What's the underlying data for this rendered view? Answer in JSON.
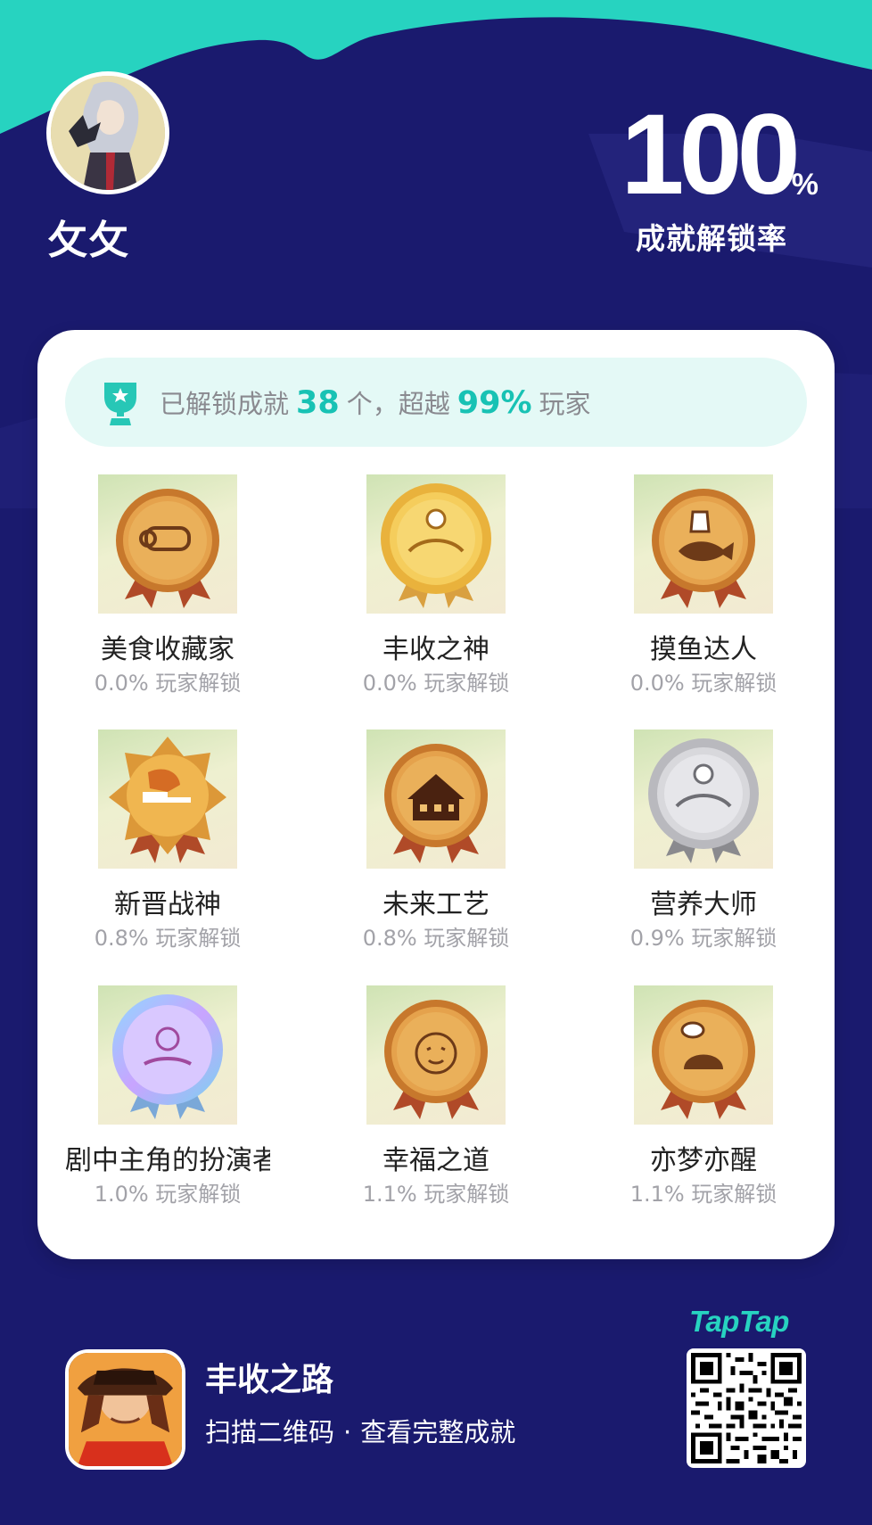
{
  "profile": {
    "user_name": "攵攵",
    "avatar_icon": "user-avatar"
  },
  "completion": {
    "rate_value": "100",
    "rate_unit": "%",
    "label": "成就解锁率"
  },
  "summary": {
    "prefix": "已解锁成就",
    "unlocked_count": "38",
    "middle": "个，超越",
    "beat_percent": "99%",
    "suffix": "玩家",
    "icon": "trophy-icon"
  },
  "achievements": [
    {
      "name": "美食收藏家",
      "rate": "0.0% 玩家解锁",
      "icon": "scroll-medal-icon",
      "tier": "bronze"
    },
    {
      "name": "丰收之神",
      "rate": "0.0% 玩家解锁",
      "icon": "harvest-god-medal-icon",
      "tier": "gold"
    },
    {
      "name": "摸鱼达人",
      "rate": "0.0% 玩家解锁",
      "icon": "fish-medal-icon",
      "tier": "bronze"
    },
    {
      "name": "新晋战神",
      "rate": "0.8% 玩家解锁",
      "icon": "muscle-medal-icon",
      "tier": "gold-star"
    },
    {
      "name": "未来工艺",
      "rate": "0.8% 玩家解锁",
      "icon": "house-medal-icon",
      "tier": "bronze"
    },
    {
      "name": "营养大师",
      "rate": "0.9% 玩家解锁",
      "icon": "nutrition-medal-icon",
      "tier": "silver"
    },
    {
      "name": "剧中主角的扮演者",
      "rate": "1.0% 玩家解锁",
      "icon": "actor-medal-icon",
      "tier": "holographic"
    },
    {
      "name": "幸福之道",
      "rate": "1.1% 玩家解锁",
      "icon": "happy-face-medal-icon",
      "tier": "bronze"
    },
    {
      "name": "亦梦亦醒",
      "rate": "1.1% 玩家解锁",
      "icon": "sleepy-face-medal-icon",
      "tier": "bronze"
    }
  ],
  "footer": {
    "game_name": "丰收之路",
    "scan_text": "扫描二维码",
    "separator": "·",
    "view_text": "查看完整成就",
    "brand": "TapTap",
    "qr_icon": "qr-code"
  },
  "colors": {
    "background": "#1a1a6e",
    "accent_teal": "#27d3c0",
    "summary_bg": "#e4f9f6",
    "highlight": "#18c2b4"
  }
}
